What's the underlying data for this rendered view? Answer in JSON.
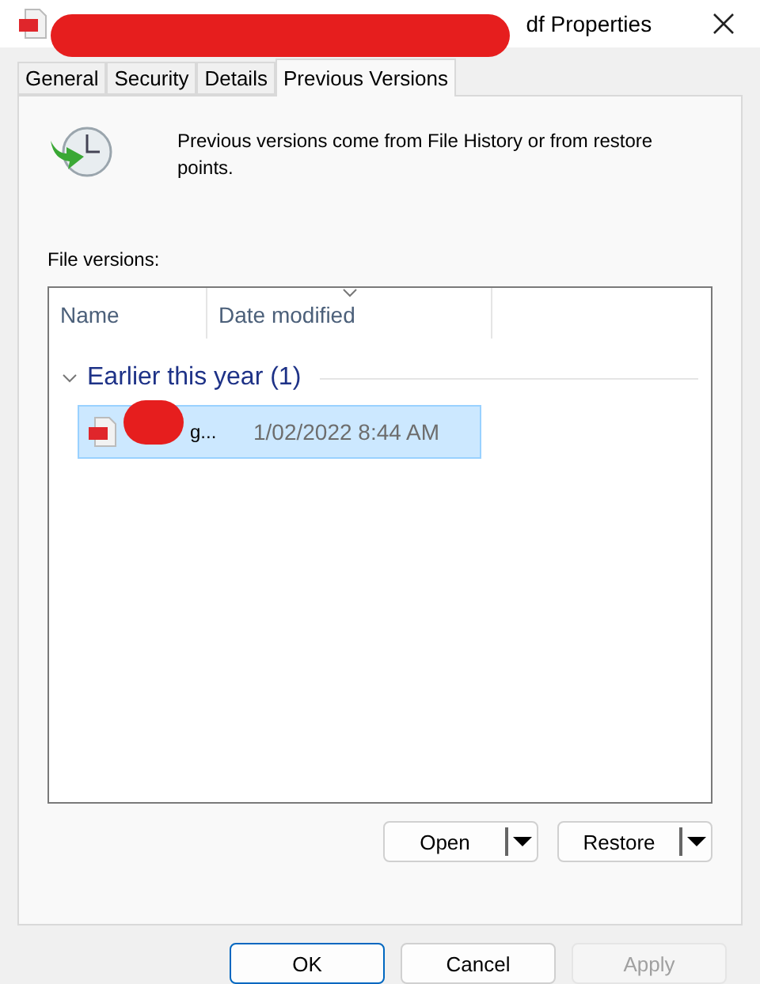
{
  "window": {
    "title": "df Properties",
    "title_redacted": true
  },
  "tabs": [
    {
      "label": "General",
      "selected": false
    },
    {
      "label": "Security",
      "selected": false
    },
    {
      "label": "Details",
      "selected": false
    },
    {
      "label": "Previous Versions",
      "selected": true
    }
  ],
  "info": "Previous versions come from File History or from restore points.",
  "list_label": "File versions:",
  "columns": [
    {
      "label": "Name",
      "sorted": false
    },
    {
      "label": "Date modified",
      "sorted": true
    }
  ],
  "groups": [
    {
      "title": "Earlier this year (1)",
      "expanded": true,
      "rows": [
        {
          "name": "g...",
          "name_redacted": true,
          "date": "1/02/2022 8:44 AM",
          "selected": true
        }
      ]
    }
  ],
  "actions": [
    "Open",
    "Restore"
  ],
  "buttons": [
    {
      "label": "OK",
      "default": true,
      "disabled": false
    },
    {
      "label": "Cancel",
      "default": false,
      "disabled": false
    },
    {
      "label": "Apply",
      "default": false,
      "disabled": true
    }
  ]
}
